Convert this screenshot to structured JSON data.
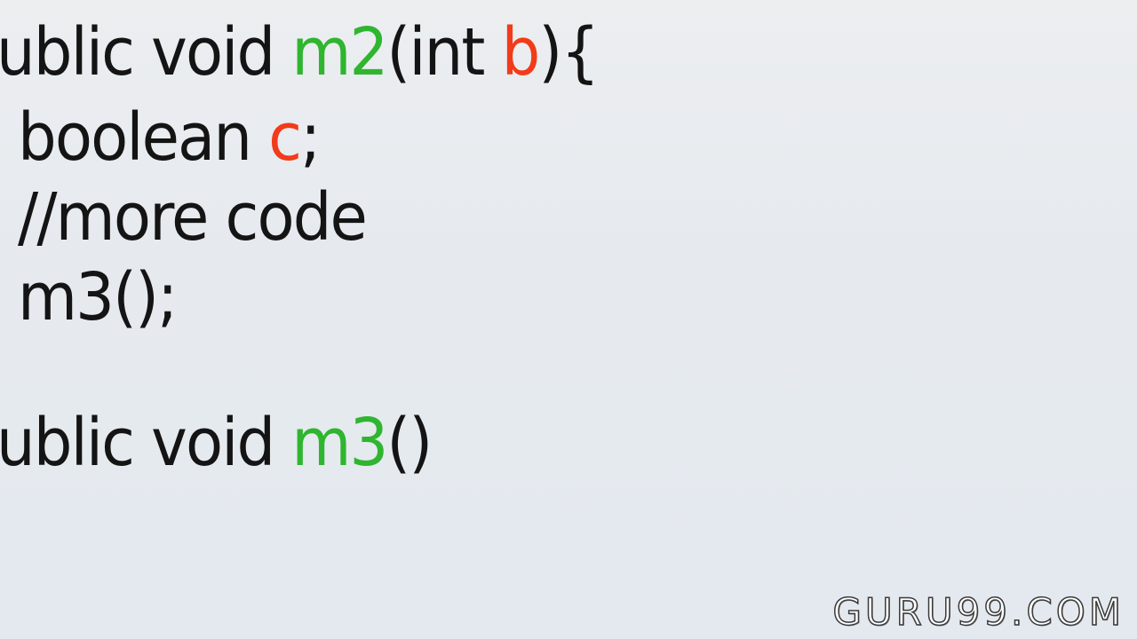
{
  "code": {
    "line1": {
      "part1": "ublic void ",
      "method": "m2",
      "part2": "(int ",
      "param": "b",
      "part3": "){"
    },
    "line2": {
      "part1": "boolean ",
      "var": "c",
      "part2": ";"
    },
    "line3": {
      "text": "//more code"
    },
    "line4": {
      "text": "m3();"
    },
    "line5": {
      "part1": "ublic void ",
      "method": "m3",
      "part2": "()"
    }
  },
  "watermark": {
    "text": "GURU99.COM"
  },
  "colors": {
    "method_name": "#2fb52f",
    "variable": "#f23b1a",
    "text": "#141414",
    "background": "#e6eaef"
  }
}
